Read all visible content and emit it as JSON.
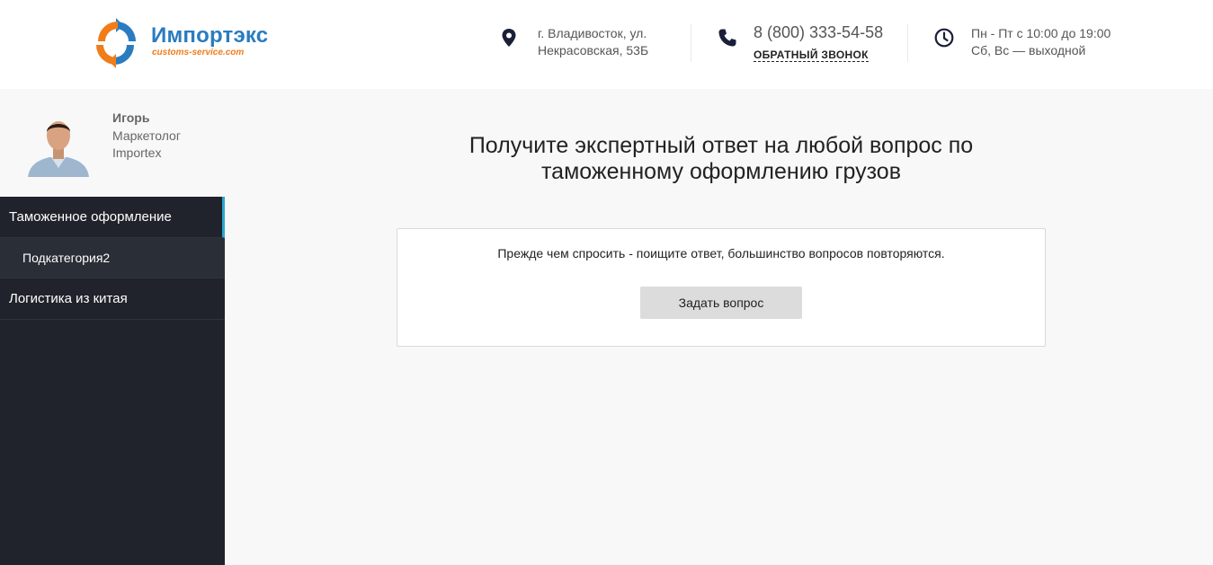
{
  "header": {
    "logo": {
      "name": "Импортэкс",
      "subtitle": "customs-service.com"
    },
    "address": {
      "icon": "map-pin-icon",
      "line1": "г. Владивосток, ул.",
      "line2": "Некрасовская, 53Б"
    },
    "phone": {
      "icon": "phone-icon",
      "number": "8 (800) 333-54-58",
      "callback_label": "ОБРАТНЫЙ ЗВОНОК"
    },
    "hours": {
      "icon": "clock-icon",
      "line1": "Пн - Пт с 10:00 до 19:00",
      "line2": "Сб, Вс — выходной"
    }
  },
  "profile": {
    "name": "Игорь",
    "role": "Маркетолог",
    "company": "Importex"
  },
  "menu": {
    "items": [
      {
        "label": "Таможенное оформление",
        "active": true
      },
      {
        "label": "Подкатегория2",
        "sub": true
      },
      {
        "label": "Логистика из китая"
      }
    ]
  },
  "main": {
    "title": "Получите экспертный ответ на любой вопрос по таможенному оформлению грузов",
    "card_text": "Прежде чем спросить - поищите ответ, большинство вопросов повторяются.",
    "ask_button": "Задать вопрос"
  },
  "colors": {
    "sidebar_bg": "#20232b",
    "accent_active": "#2aa7cf",
    "logo_blue": "#2a7cc0",
    "logo_orange": "#f07d1a",
    "page_bg": "#f8f8f8"
  }
}
